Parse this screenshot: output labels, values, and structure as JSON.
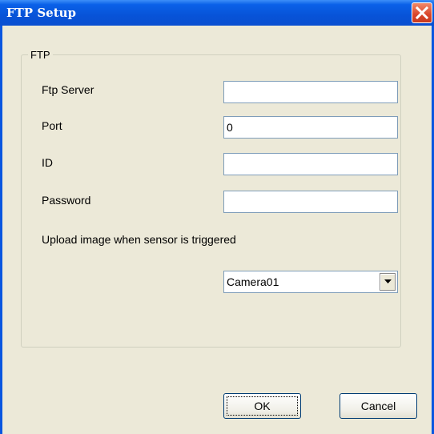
{
  "window": {
    "title": "FTP Setup"
  },
  "group": {
    "title": "FTP"
  },
  "fields": {
    "ftp_server": {
      "label": "Ftp Server",
      "value": ""
    },
    "port": {
      "label": "Port",
      "value": "0"
    },
    "id": {
      "label": "ID",
      "value": ""
    },
    "password": {
      "label": "Password",
      "value": ""
    }
  },
  "upload": {
    "label": "Upload image when sensor is triggered",
    "selected": "Camera01"
  },
  "buttons": {
    "ok": "OK",
    "cancel": "Cancel"
  },
  "colors": {
    "titlebar": "#0a56e0",
    "dialog_bg": "#ece9d8",
    "close": "#d9452a"
  }
}
